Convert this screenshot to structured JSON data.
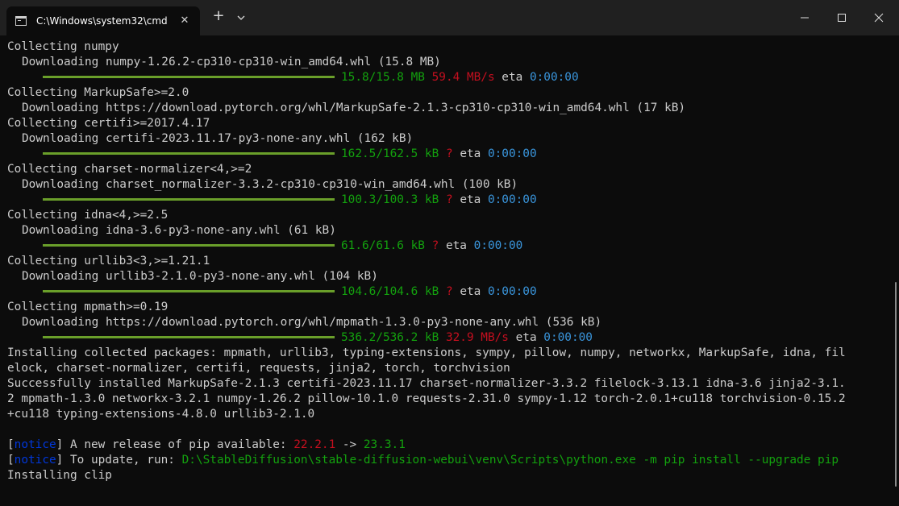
{
  "titlebar": {
    "tab_title": "C:\\Windows\\system32\\cmd",
    "tab_close_glyph": "✕",
    "new_tab_glyph": "+",
    "icons": [
      "console-icon",
      "close-icon",
      "plus-icon",
      "chevron-down-icon",
      "minimize-icon",
      "maximize-icon",
      "window-close-icon"
    ]
  },
  "colors": {
    "background": "#0c0c0c",
    "titlebar": "#202020",
    "text": "#cccccc",
    "progress_bar": "#6a9f2a",
    "green": "#13a10e",
    "red": "#c50f1f",
    "cyan": "#3a96dd",
    "blue": "#0037da"
  },
  "terminal": {
    "l01": "Collecting numpy",
    "l02": "Downloading numpy-1.26.2-cp310-cp310-win_amd64.whl (15.8 MB)",
    "p1_size": "15.8/15.8 MB",
    "p1_speed": "59.4 MB/s",
    "p1_eta_label": "eta",
    "p1_eta": "0:00:00",
    "l04": "Collecting MarkupSafe>=2.0",
    "l05": "Downloading https://download.pytorch.org/whl/MarkupSafe-2.1.3-cp310-cp310-win_amd64.whl (17 kB)",
    "l06": "Collecting certifi>=2017.4.17",
    "l07": "Downloading certifi-2023.11.17-py3-none-any.whl (162 kB)",
    "p2_size": "162.5/162.5 kB",
    "p2_speed": "?",
    "p2_eta_label": "eta",
    "p2_eta": "0:00:00",
    "l09": "Collecting charset-normalizer<4,>=2",
    "l10": "Downloading charset_normalizer-3.3.2-cp310-cp310-win_amd64.whl (100 kB)",
    "p3_size": "100.3/100.3 kB",
    "p3_speed": "?",
    "p3_eta_label": "eta",
    "p3_eta": "0:00:00",
    "l12": "Collecting idna<4,>=2.5",
    "l13": "Downloading idna-3.6-py3-none-any.whl (61 kB)",
    "p4_size": "61.6/61.6 kB",
    "p4_speed": "?",
    "p4_eta_label": "eta",
    "p4_eta": "0:00:00",
    "l15": "Collecting urllib3<3,>=1.21.1",
    "l16": "Downloading urllib3-2.1.0-py3-none-any.whl (104 kB)",
    "p5_size": "104.6/104.6 kB",
    "p5_speed": "?",
    "p5_eta_label": "eta",
    "p5_eta": "0:00:00",
    "l18": "Collecting mpmath>=0.19",
    "l19": "Downloading https://download.pytorch.org/whl/mpmath-1.3.0-py3-none-any.whl (536 kB)",
    "p6_size": "536.2/536.2 kB",
    "p6_speed": "32.9 MB/s",
    "p6_eta_label": "eta",
    "p6_eta": "0:00:00",
    "l21": "Installing collected packages: mpmath, urllib3, typing-extensions, sympy, pillow, numpy, networkx, MarkupSafe, idna, fil",
    "l22": "elock, charset-normalizer, certifi, requests, jinja2, torch, torchvision",
    "l23": "Successfully installed MarkupSafe-2.1.3 certifi-2023.11.17 charset-normalizer-3.3.2 filelock-3.13.1 idna-3.6 jinja2-3.1.",
    "l24": "2 mpmath-1.3.0 networkx-3.2.1 numpy-1.26.2 pillow-10.1.0 requests-2.31.0 sympy-1.12 torch-2.0.1+cu118 torchvision-0.15.2",
    "l25": "+cu118 typing-extensions-4.8.0 urllib3-2.1.0",
    "n1_open": "[",
    "n1_tag": "notice",
    "n1_close": "]",
    "n1_text": " A new release of pip available: ",
    "n1_old": "22.2.1",
    "n1_arrow": " -> ",
    "n1_new": "23.3.1",
    "n2_open": "[",
    "n2_tag": "notice",
    "n2_close": "]",
    "n2_text": " To update, run: ",
    "n2_cmd": "D:\\StableDiffusion\\stable-diffusion-webui\\venv\\Scripts\\python.exe -m pip install --upgrade pip",
    "l29": "Installing clip"
  }
}
